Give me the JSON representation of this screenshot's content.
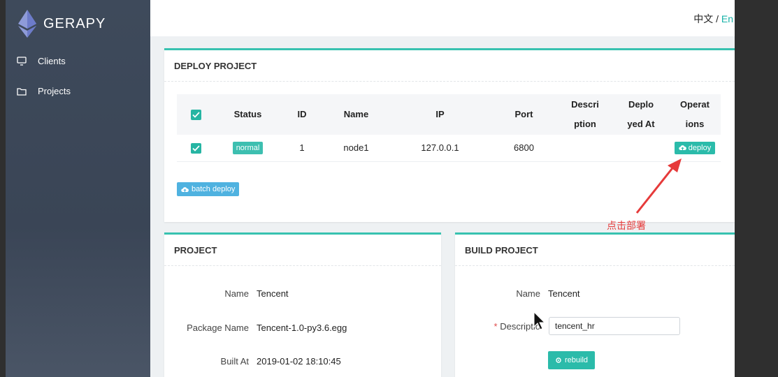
{
  "app": {
    "name": "GERAPY"
  },
  "sidebar": {
    "items": [
      {
        "label": "Clients",
        "icon": "monitor-icon"
      },
      {
        "label": "Projects",
        "icon": "folder-icon"
      }
    ]
  },
  "topbar": {
    "lang_zh": "中文",
    "lang_sep": " / ",
    "lang_en": "En"
  },
  "deploy": {
    "title": "DEPLOY PROJECT",
    "columns": {
      "status": "Status",
      "id": "ID",
      "name": "Name",
      "ip": "IP",
      "port": "Port",
      "description_1": "Descri",
      "description_2": "ption",
      "deployed_1": "Deplo",
      "deployed_2": "yed At",
      "operations_1": "Operat",
      "operations_2": "ions"
    },
    "rows": [
      {
        "status": "normal",
        "id": "1",
        "name": "node1",
        "ip": "127.0.0.1",
        "port": "6800",
        "description": "",
        "deployed_at": "",
        "action": "deploy"
      }
    ],
    "batch_label": "batch deploy",
    "annotation": "点击部署"
  },
  "project": {
    "title": "PROJECT",
    "fields": [
      {
        "label": "Name",
        "value": "Tencent"
      },
      {
        "label": "Package Name",
        "value": "Tencent-1.0-py3.6.egg"
      },
      {
        "label": "Built At",
        "value": "2019-01-02 18:10:45"
      }
    ]
  },
  "build": {
    "title": "BUILD PROJECT",
    "name_label": "Name",
    "name_value": "Tencent",
    "required_mark": "*",
    "description_label": "Descriptio",
    "description_value": "tencent_hr",
    "rebuild_label": "rebuild"
  },
  "colors": {
    "accent": "#2bbbaa",
    "sidebar": "#3e4a5b",
    "batch": "#4fb2e0",
    "annotation": "#e63a3a"
  }
}
